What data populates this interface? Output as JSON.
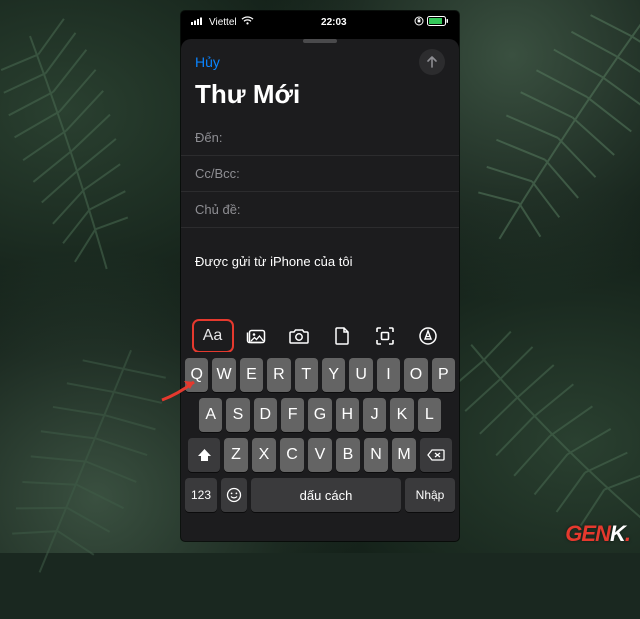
{
  "status": {
    "carrier": "Viettel",
    "time": "22:03"
  },
  "sheet": {
    "cancel": "Hủy",
    "title": "Thư Mới",
    "to_label": "Đến:",
    "cc_label": "Cc/Bcc:",
    "subject_label": "Chủ đề:",
    "signature": "Được gửi từ iPhone của tôi"
  },
  "toolbar": {
    "format": "Aa"
  },
  "keyboard": {
    "row1": [
      "Q",
      "W",
      "E",
      "R",
      "T",
      "Y",
      "U",
      "I",
      "O",
      "P"
    ],
    "row2": [
      "A",
      "S",
      "D",
      "F",
      "G",
      "H",
      "J",
      "K",
      "L"
    ],
    "row3": [
      "Z",
      "X",
      "C",
      "V",
      "B",
      "N",
      "M"
    ],
    "numkey": "123",
    "space": "dấu cách",
    "return": "Nhập"
  },
  "watermark": {
    "part1": "GEN",
    "part2": "K"
  }
}
